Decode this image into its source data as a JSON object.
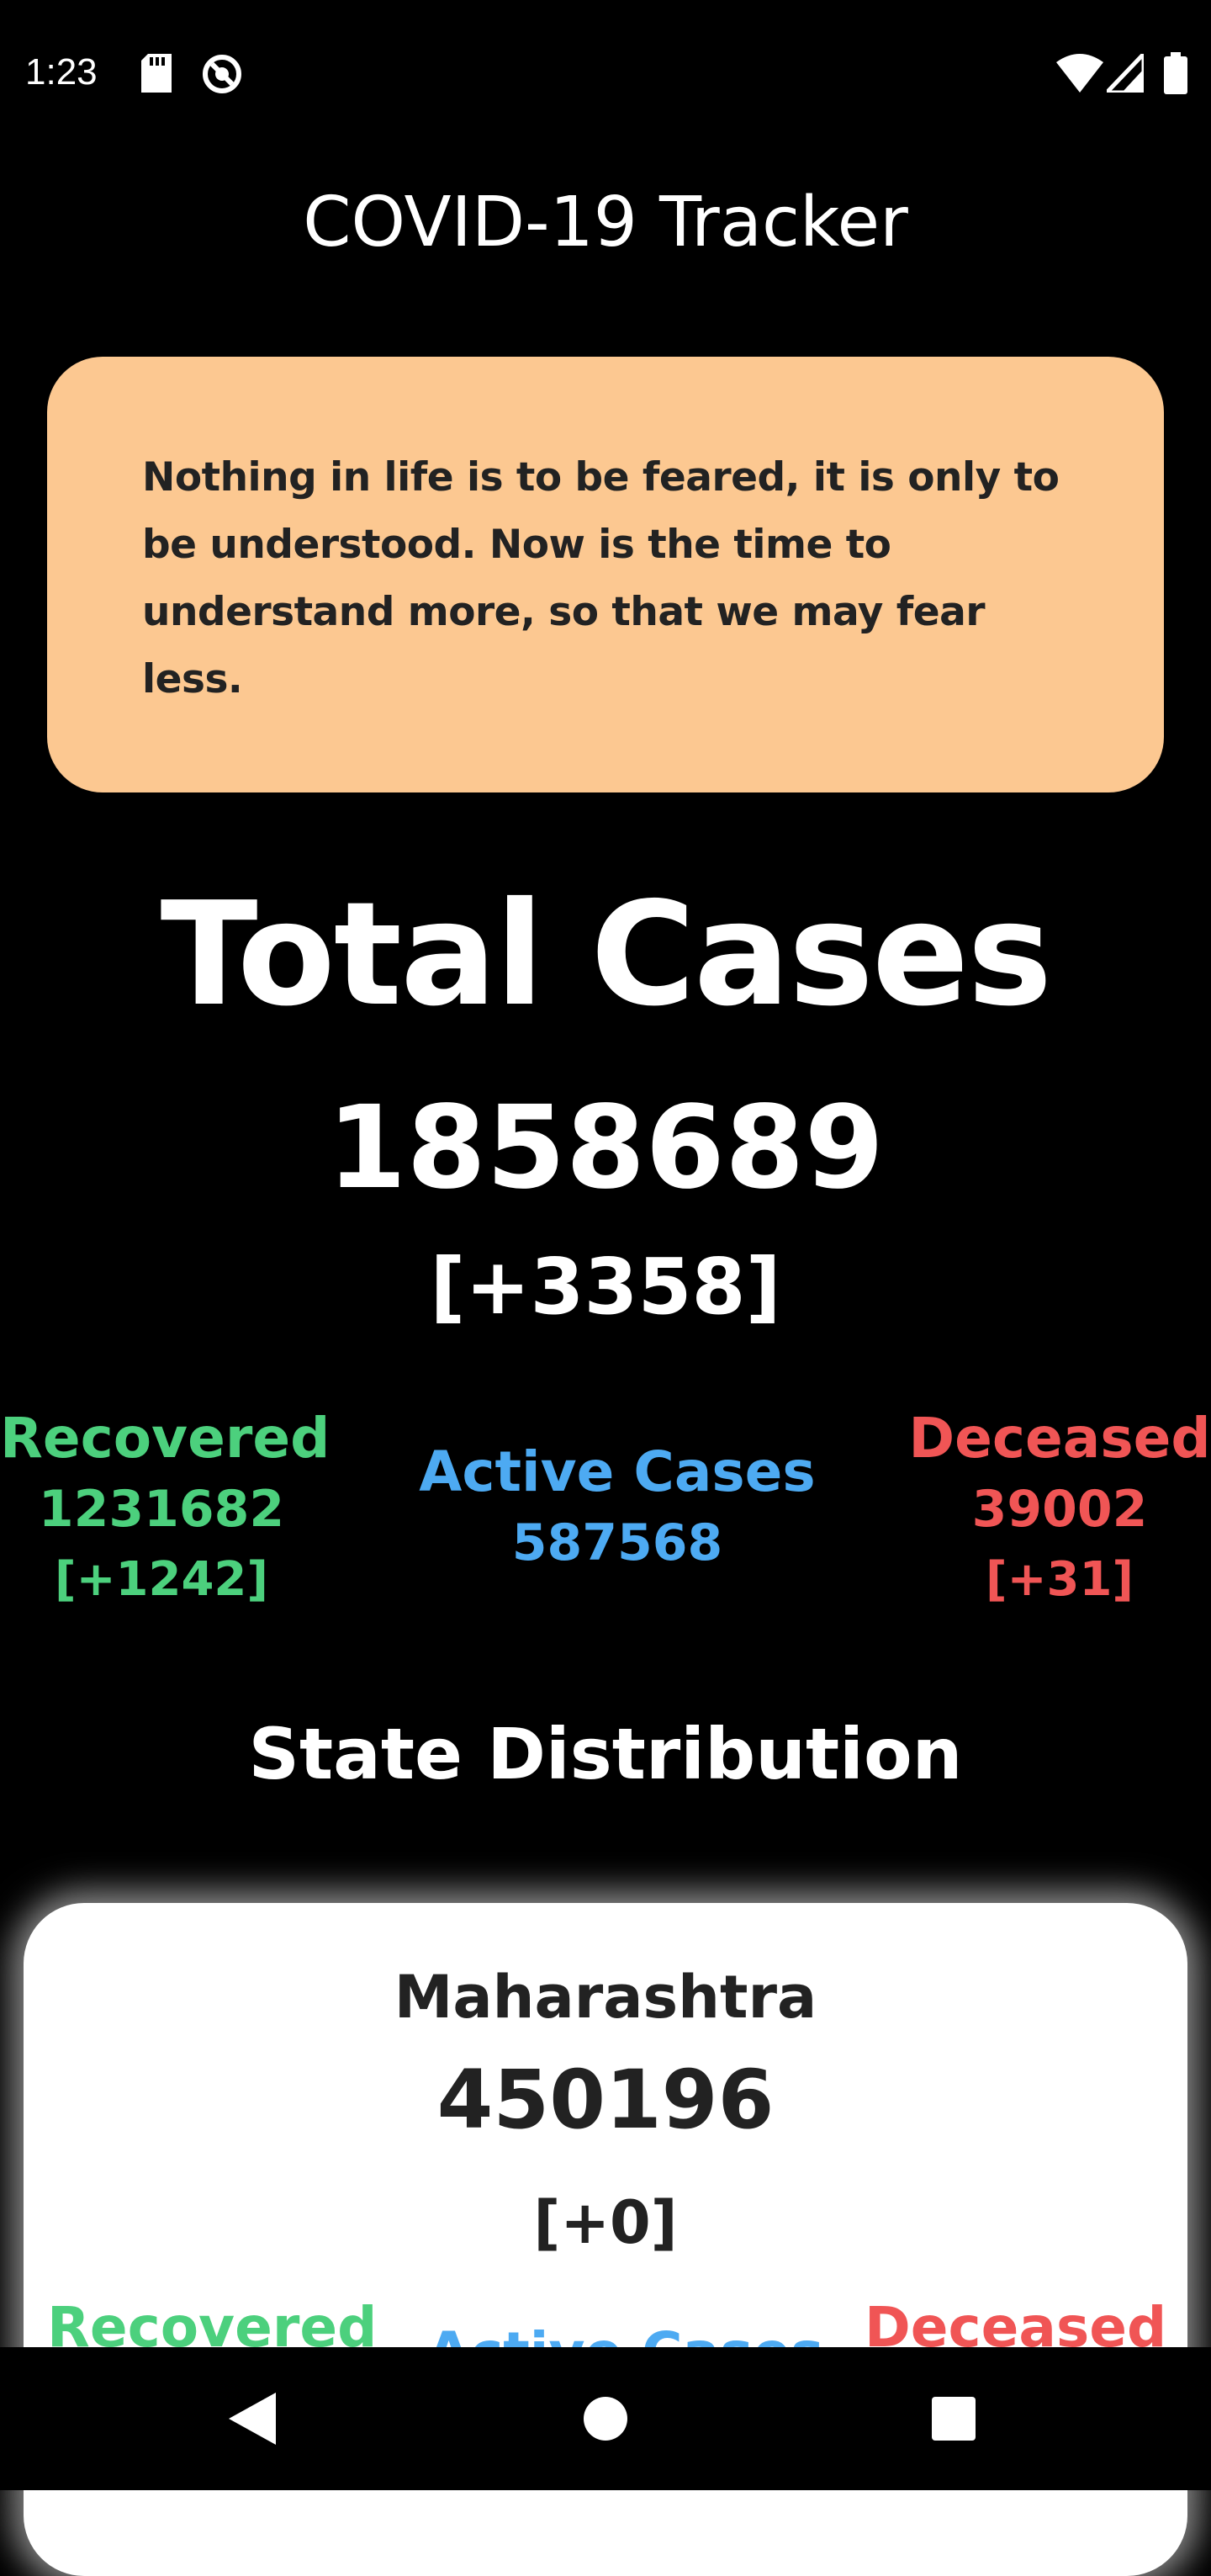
{
  "status_bar": {
    "time": "1:23",
    "icons": [
      "sd-card-icon",
      "do-not-disturb-icon",
      "wifi-icon",
      "signal-icon",
      "battery-icon"
    ]
  },
  "app": {
    "title": "COVID-19 Tracker"
  },
  "quote": {
    "text": "Nothing in life is to be feared, it is only to be understood. Now is the time to understand more, so that we may fear less.",
    "background": "#FCC891"
  },
  "totals": {
    "heading": "Total Cases",
    "value": "1858689",
    "delta": "[+3358]"
  },
  "stats": {
    "recovered": {
      "label": "Recovered",
      "value": "1231682",
      "delta": "[+1242]",
      "color": "#4CD07D"
    },
    "active": {
      "label": "Active Cases",
      "value": "587568",
      "color": "#4DAAF2"
    },
    "deceased": {
      "label": "Deceased",
      "value": "39002",
      "delta": "[+31]",
      "color": "#F05555"
    }
  },
  "state_section": {
    "title": "State Distribution",
    "states": [
      {
        "name": "Maharashtra",
        "value": "450196",
        "delta": "[+0]",
        "recovered_label": "Recovered",
        "active_label": "Active Cases",
        "deceased_label": "Deceased"
      }
    ]
  },
  "nav": {
    "icons": [
      "back-icon",
      "home-icon",
      "recents-icon"
    ]
  }
}
